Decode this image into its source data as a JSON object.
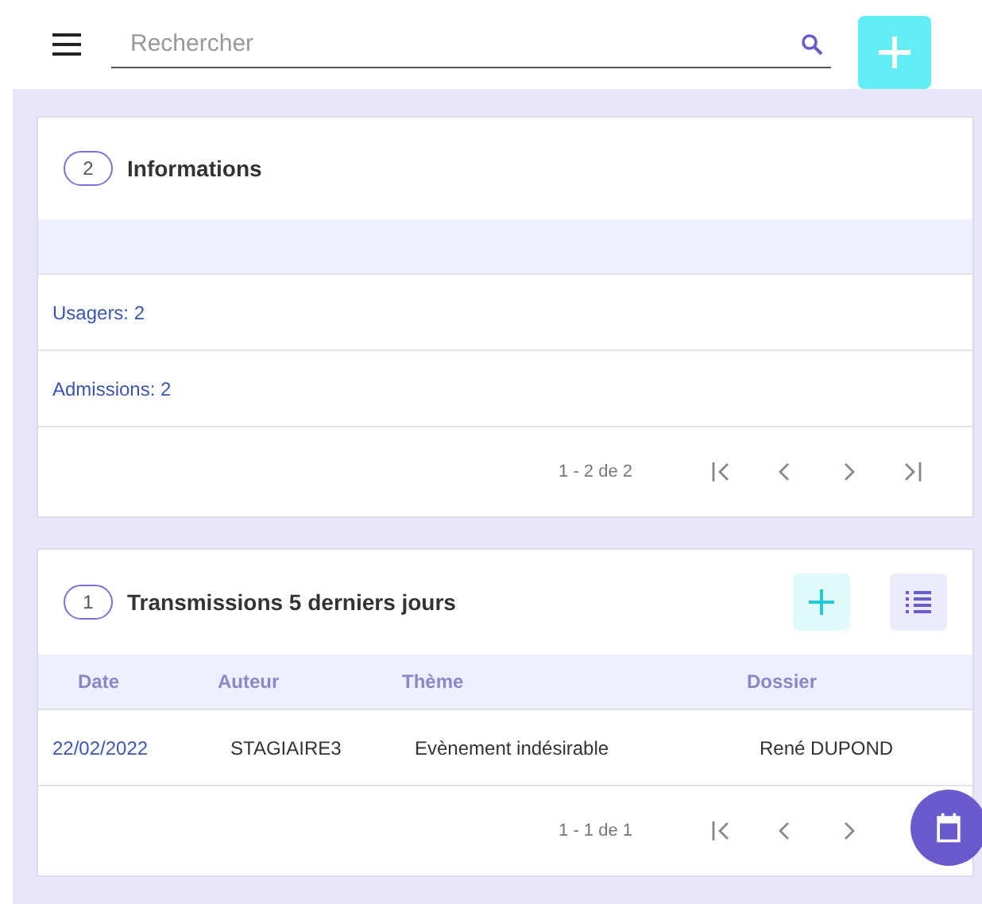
{
  "search": {
    "placeholder": "Rechercher"
  },
  "informations": {
    "count": "2",
    "title": "Informations",
    "rows": [
      "Usagers: 2",
      "Admissions: 2"
    ],
    "pager": "1 - 2 de 2"
  },
  "transmissions": {
    "count": "1",
    "title": "Transmissions 5 derniers jours",
    "columns": [
      "Date",
      "Auteur",
      "Thème",
      "Dossier"
    ],
    "rows": [
      [
        "22/02/2022",
        "STAGIAIRE3",
        "Evènement indésirable",
        "René DUPOND"
      ]
    ],
    "pager": "1 - 1 de 1"
  }
}
